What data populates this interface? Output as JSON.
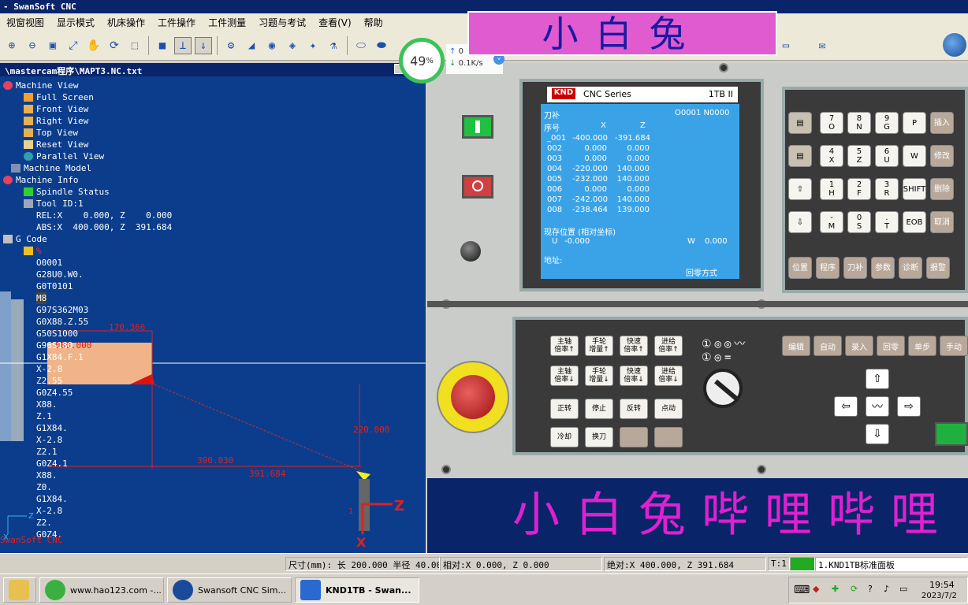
{
  "app": {
    "title": "- SwanSoft CNC"
  },
  "menu": [
    "视窗视图",
    "显示模式",
    "机床操作",
    "工件操作",
    "工件测量",
    "习题与考试",
    "查看(V)",
    "帮助"
  ],
  "overlay": {
    "title": "小白兔",
    "banner": "小白兔哔哩哔哩"
  },
  "net": {
    "percent": "49",
    "percent_unit": "%",
    "up": "0",
    "down": "0.1K/s",
    "up_arrow": "↑",
    "down_arrow": "↓",
    "badge": "⌄"
  },
  "file": {
    "path": "\\mastercam程序\\MAPT3.NC.txt"
  },
  "tree": {
    "machine_view": "Machine View",
    "full_screen": "Full Screen",
    "front_view": "Front View",
    "right_view": "Right View",
    "top_view": "Top View",
    "reset_view": "Reset View",
    "parallel_view": "Parallel View",
    "machine_model": "Machine Model",
    "machine_info": "Machine Info",
    "spindle_status": "Spindle Status",
    "tool_id": "Tool ID:1",
    "rel": "REL:X    0.000, Z    0.000",
    "abs": "ABS:X  400.000, Z  391.684",
    "gcode": "G Code",
    "current": "%",
    "lines": [
      "O0001",
      "G28U0.W0.",
      "G0T0101",
      "M8",
      "G97S362M03",
      "G0X88.Z.55",
      "G50S1000",
      "G96S180",
      "G1X84.F.1",
      "X-2.8",
      "Z2.55",
      "G0Z4.55",
      "X88.",
      "Z.1",
      "G1X84.",
      "X-2.8",
      "Z2.1",
      "G0Z4.1",
      "X88.",
      "Z0.",
      "G1X84.",
      "X-2.8",
      "Z2.",
      "G0Z4."
    ],
    "watermark": "SwanSoft CNC"
  },
  "viewport": {
    "dim1": "170.366",
    "dim2": "000.000",
    "dim3": "220.000",
    "dim4": "390.030",
    "dim5": "391.684",
    "axis_z": "Z",
    "axis_x": "X",
    "axis_mini_x": "X",
    "axis_mini_z": "Z",
    "tool_label": "1"
  },
  "lcd": {
    "brand": "KND",
    "series": "CNC Series",
    "model": "1TB II",
    "screen_title": "刀补",
    "program": "O0001 N0000",
    "col_no": "序号",
    "col_x": "X",
    "col_z": "Z",
    "rows": [
      {
        "no": "_001",
        "x": "-400.000",
        "z": "-391.684"
      },
      {
        "no": "002",
        "x": "0.000",
        "z": "0.000"
      },
      {
        "no": "003",
        "x": "0.000",
        "z": "0.000"
      },
      {
        "no": "004",
        "x": "-220.000",
        "z": "140.000"
      },
      {
        "no": "005",
        "x": "-232.000",
        "z": "140.000"
      },
      {
        "no": "006",
        "x": "0.000",
        "z": "0.000"
      },
      {
        "no": "007",
        "x": "-242.000",
        "z": "140.000"
      },
      {
        "no": "008",
        "x": "-238.464",
        "z": "139.000"
      }
    ],
    "pos_title": "现存位置 (相对坐标)",
    "u_label": "U",
    "u_value": "-0.000",
    "w_label": "W",
    "w_value": "0.000",
    "addr": "地址:",
    "mode": "回零方式"
  },
  "keys": {
    "row1": [
      "7\nO",
      "8\nN",
      "9\nG",
      "P",
      "插入"
    ],
    "row2": [
      "4\nX",
      "5\nZ",
      "6\nU",
      "W",
      "修改"
    ],
    "row3": [
      "1\nH",
      "2\nF",
      "3\nR",
      "SHIFT",
      "删除"
    ],
    "row4": [
      "-\nM",
      "0\nS",
      ".\nT",
      "EOB",
      "取消"
    ],
    "func": [
      "位置",
      "程序",
      "刀补",
      "参数",
      "诊断",
      "报警"
    ],
    "up": "⇧",
    "down": "⇩"
  },
  "ops": {
    "r1": [
      "主轴\n倍率↑",
      "手轮\n增量↑",
      "快速\n倍率↑",
      "进给\n倍率↑"
    ],
    "r2": [
      "主轴\n倍率↓",
      "手轮\n增量↓",
      "快速\n倍率↓",
      "进给\n倍率↓"
    ],
    "r3": [
      "正转",
      "停止",
      "反转",
      "点动"
    ],
    "r4": [
      "冷却",
      "换刀"
    ],
    "modes": [
      "编辑",
      "自动",
      "录入",
      "回零",
      "单步",
      "手动"
    ]
  },
  "status": {
    "size": "尺寸(mm): 长 200.000 半径  40.00",
    "rel": "相对:X    0.000, Z    0.000",
    "abs": "绝对:X  400.000, Z  391.684",
    "tool": "T:1",
    "panel": "1.KND1TB标准面板"
  },
  "taskbar": {
    "t1": "www.hao123.com -...",
    "t2": "Swansoft CNC Sim...",
    "t3": "KND1TB - Swan...",
    "time": "19:54",
    "date": "2023/7/2"
  },
  "colors": {
    "panel": "#0b3d8c",
    "lcd": "#3aa3e8",
    "accent": "#e05bd0"
  }
}
